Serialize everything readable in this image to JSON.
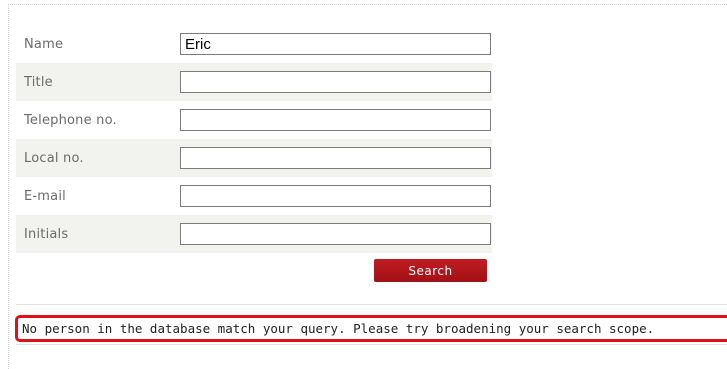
{
  "form": {
    "fields": [
      {
        "label": "Name",
        "value": "Eric"
      },
      {
        "label": "Title",
        "value": ""
      },
      {
        "label": "Telephone no.",
        "value": ""
      },
      {
        "label": "Local no.",
        "value": ""
      },
      {
        "label": "E-mail",
        "value": ""
      },
      {
        "label": "Initials",
        "value": ""
      }
    ],
    "search_label": "Search"
  },
  "result": {
    "message": "No person in the database match your query. Please try broadening your search scope."
  },
  "colors": {
    "button": "#b0161c",
    "highlight_border": "#e0101a",
    "row_shade": "#f2f2ee"
  }
}
